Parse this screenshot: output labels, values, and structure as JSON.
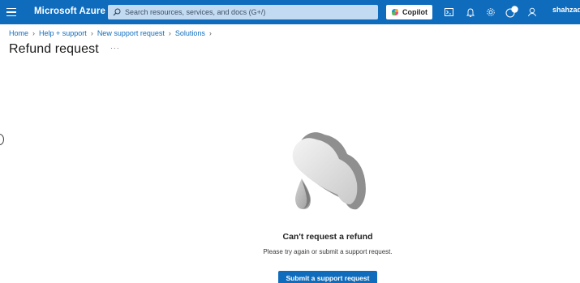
{
  "topbar": {
    "menu_icon": "hamburger-icon",
    "brand": "Microsoft Azure",
    "search_placeholder": "Search resources, services, and docs (G+/)",
    "copilot_label": "Copilot",
    "icons": [
      "cloud-shell-icon",
      "bell-icon",
      "gear-icon",
      "help-icon",
      "feedback-icon"
    ],
    "user": "shahzad"
  },
  "breadcrumb": {
    "items": [
      "Home",
      "Help + support",
      "New support request",
      "Solutions"
    ]
  },
  "page": {
    "title": "Refund request",
    "more": "···"
  },
  "empty_state": {
    "illustration": "cloud-raindrop-illustration",
    "title": "Can't request a refund",
    "description": "Please try again or submit a support request.",
    "button_label": "Submit a support request"
  },
  "colors": {
    "brand_blue": "#0f6cbd",
    "search_bg": "#c3dbf2",
    "title_text": "#1b1a19"
  }
}
